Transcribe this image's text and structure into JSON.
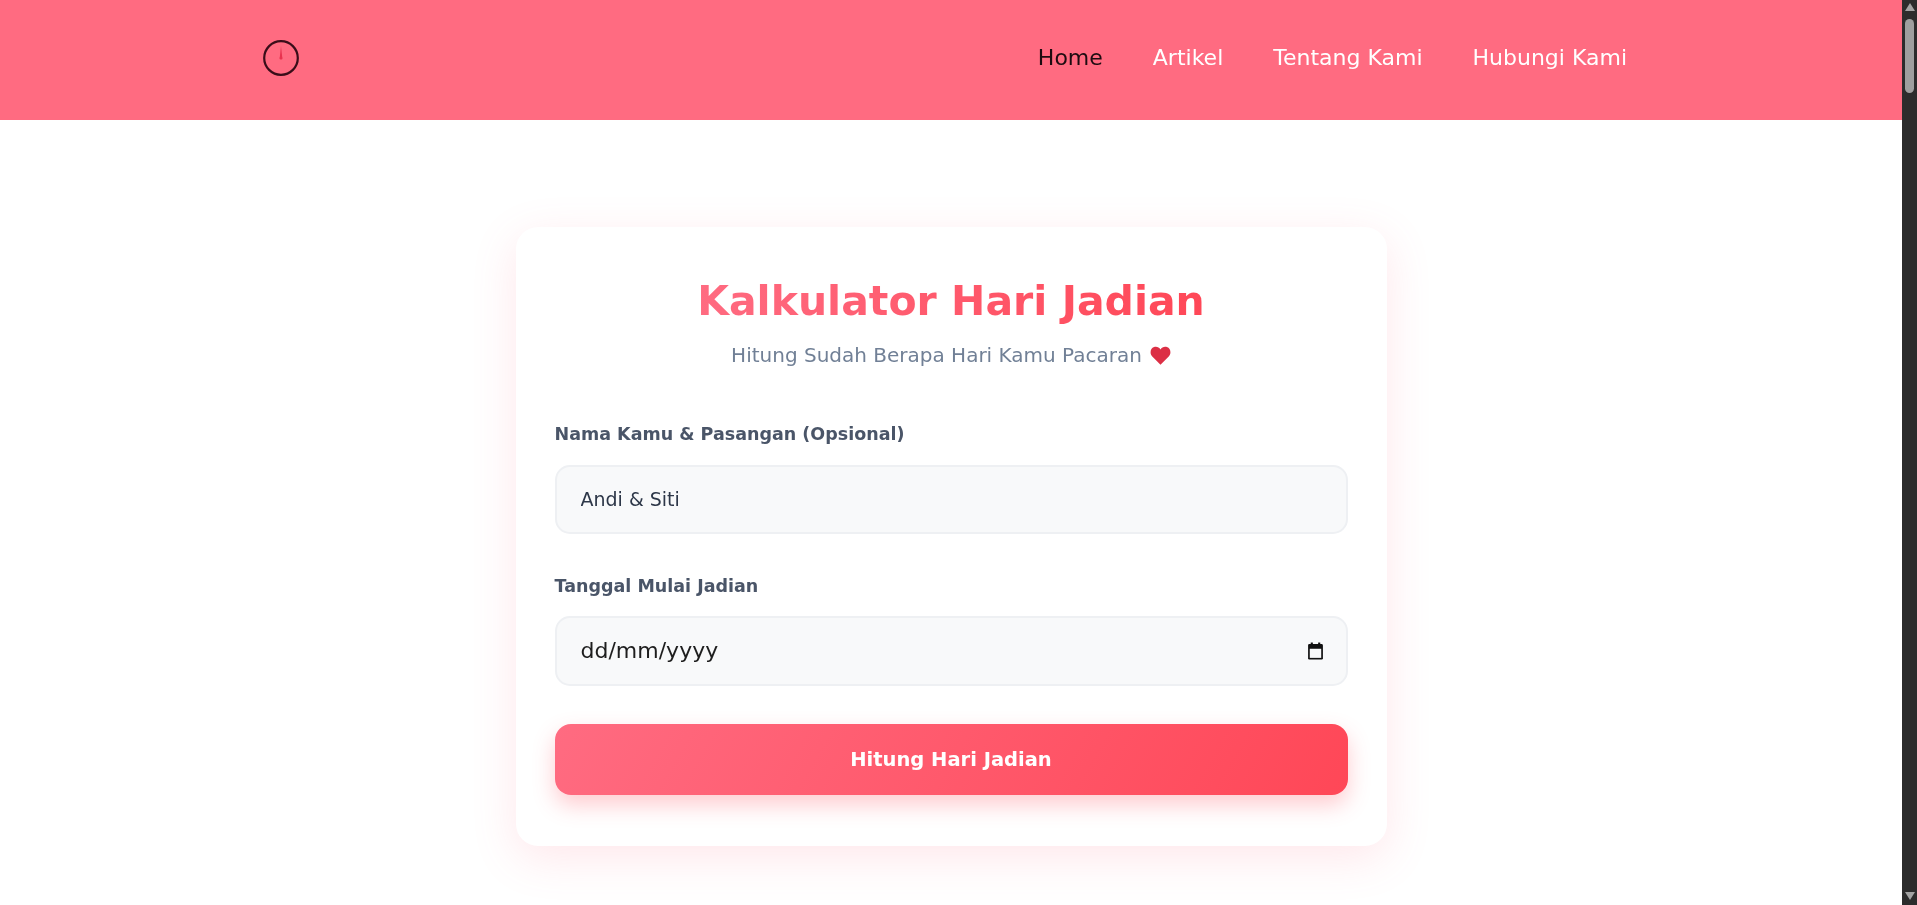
{
  "navbar": {
    "links": [
      {
        "label": "Home",
        "selected": true
      },
      {
        "label": "Artikel",
        "selected": false
      },
      {
        "label": "Tentang Kami",
        "selected": false
      },
      {
        "label": "Hubungi Kami",
        "selected": false
      }
    ]
  },
  "card": {
    "title": "Kalkulator Hari Jadian",
    "subtitle": "Hitung Sudah Berapa Hari Kamu Pacaran"
  },
  "form": {
    "fields": [
      {
        "kind": "text",
        "label": "Nama Kamu & Pasangan (Opsional)",
        "value": "Andi & Siti"
      },
      {
        "kind": "date",
        "label": "Tanggal Mulai Jadian",
        "placeholder": "dd/mm/yyyy"
      }
    ],
    "submit": "Hitung Hari Jadian"
  }
}
